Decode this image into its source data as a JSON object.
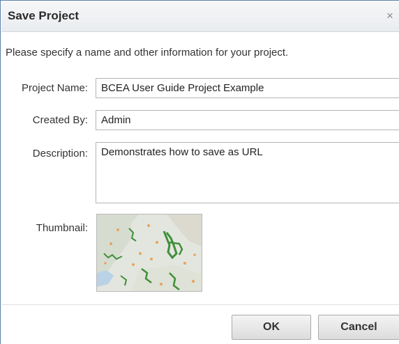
{
  "dialog": {
    "title": "Save Project",
    "close_glyph": "×",
    "intro": "Please specify a name and other information for your project."
  },
  "form": {
    "project_name": {
      "label": "Project Name:",
      "value": "BCEA User Guide Project Example"
    },
    "created_by": {
      "label": "Created By:",
      "value": "Admin"
    },
    "description": {
      "label": "Description:",
      "value": "Demonstrates how to save as URL"
    },
    "thumbnail": {
      "label": "Thumbnail:"
    }
  },
  "buttons": {
    "ok_label": "OK",
    "cancel_label": "Cancel"
  },
  "icons": {
    "close": "close-icon",
    "thumbnail": "map-thumbnail-image"
  },
  "colors": {
    "dialog_border": "#5b7fa8",
    "map_land": "#e3e6df",
    "map_green": "#3f8f3a",
    "map_orange": "#e8a35a"
  }
}
